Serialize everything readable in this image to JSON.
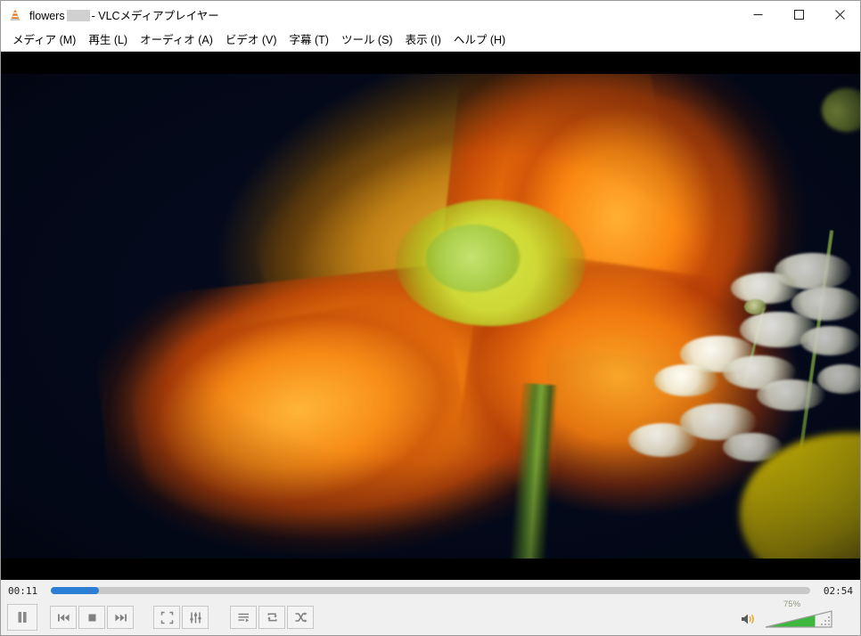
{
  "window": {
    "app_icon": "vlc-cone-icon",
    "title_prefix": "flowers",
    "title_suffix": "- VLCメディアプレイヤー",
    "redacted": true,
    "buttons": {
      "minimize": "minimize-icon",
      "maximize": "maximize-icon",
      "close": "close-icon"
    }
  },
  "menu": {
    "items": [
      {
        "label": "メディア (M)",
        "name": "menu-media"
      },
      {
        "label": "再生 (L)",
        "name": "menu-playback"
      },
      {
        "label": "オーディオ (A)",
        "name": "menu-audio"
      },
      {
        "label": "ビデオ (V)",
        "name": "menu-video"
      },
      {
        "label": "字幕 (T)",
        "name": "menu-subtitle"
      },
      {
        "label": "ツール (S)",
        "name": "menu-tools"
      },
      {
        "label": "表示 (I)",
        "name": "menu-view"
      },
      {
        "label": "ヘルプ (H)",
        "name": "menu-help"
      }
    ]
  },
  "video": {
    "description": "オレンジ色のポピーの花のクローズアップ、白いかすみ草と黄色い花",
    "background_color": "#040a1c",
    "letterbox_color": "#000000"
  },
  "seek": {
    "elapsed": "00:11",
    "total": "02:54",
    "progress_percent": 6.3,
    "fill_color": "#2a7fd4",
    "track_color": "#c8c8c8"
  },
  "controls": {
    "play_pause": {
      "label": "一時停止",
      "state": "playing",
      "icon": "pause-icon"
    },
    "previous": {
      "label": "前へ",
      "icon": "previous-icon"
    },
    "stop": {
      "label": "停止",
      "icon": "stop-icon"
    },
    "next": {
      "label": "次へ",
      "icon": "next-icon"
    },
    "fullscreen": {
      "label": "全画面表示",
      "icon": "fullscreen-icon"
    },
    "extended_settings": {
      "label": "拡張設定を表示",
      "icon": "equalizer-icon"
    },
    "playlist": {
      "label": "プレイリスト",
      "icon": "playlist-icon"
    },
    "loop": {
      "label": "ループ",
      "icon": "loop-icon"
    },
    "shuffle": {
      "label": "シャッフル",
      "icon": "shuffle-icon"
    }
  },
  "volume": {
    "icon": "speaker-icon",
    "percent_label": "75%",
    "percent_value": 75,
    "fill_color": "#3eb73e",
    "label_color": "#8a9a7a"
  }
}
